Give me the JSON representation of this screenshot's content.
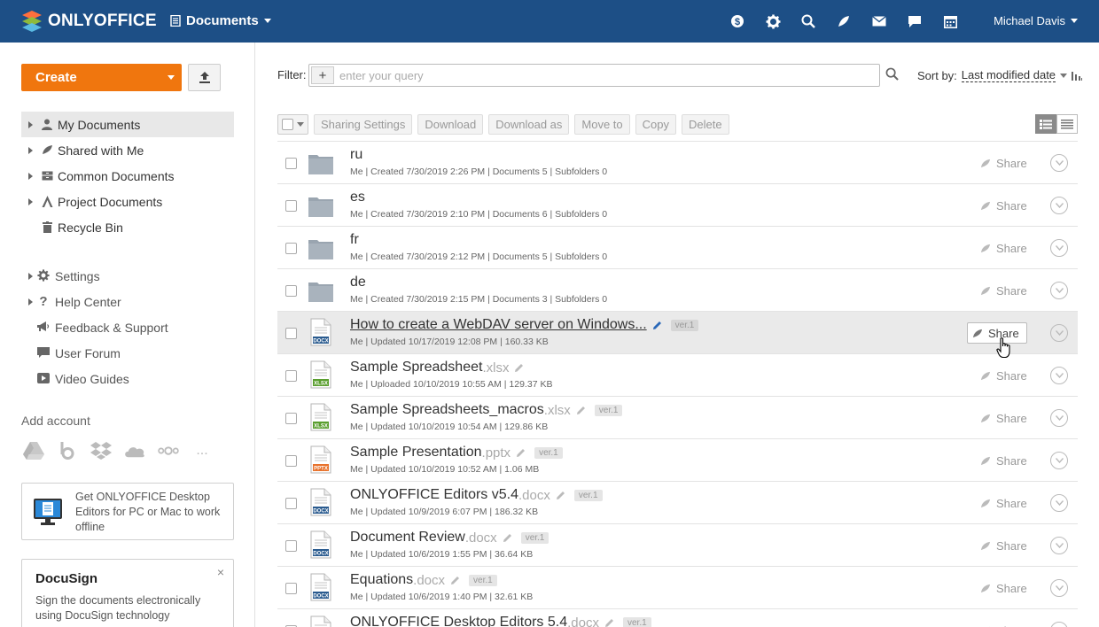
{
  "header": {
    "brand": "ONLYOFFICE",
    "module": "Documents",
    "user": "Michael Davis",
    "icons": [
      "payments-icon",
      "settings-icon",
      "search-icon",
      "feed-icon",
      "mail-icon",
      "talk-icon",
      "calendar-icon"
    ]
  },
  "sidebar": {
    "create_label": "Create",
    "tree": [
      {
        "label": "My Documents",
        "icon": "user-icon",
        "active": true
      },
      {
        "label": "Shared with Me",
        "icon": "share-icon"
      },
      {
        "label": "Common Documents",
        "icon": "common-icon"
      },
      {
        "label": "Project Documents",
        "icon": "project-icon"
      },
      {
        "label": "Recycle Bin",
        "icon": "trash-icon"
      }
    ],
    "links": [
      {
        "label": "Settings",
        "icon": "gear-icon"
      },
      {
        "label": "Help Center",
        "icon": "question-icon"
      },
      {
        "label": "Feedback & Support",
        "icon": "megaphone-icon"
      },
      {
        "label": "User Forum",
        "icon": "chat-icon"
      },
      {
        "label": "Video Guides",
        "icon": "video-icon"
      }
    ],
    "add_account": "Add account",
    "more": "...",
    "promo": "Get ONLYOFFICE Desktop Editors for PC or Mac to work offline",
    "docusign_brand": "DocuSign",
    "docusign_close": "×",
    "docusign_desc": "Sign the documents electronically using DocuSign technology"
  },
  "filter": {
    "label": "Filter:",
    "add": "+",
    "placeholder": "enter your query",
    "sort_label": "Sort by:",
    "sort_value": "Last modified date"
  },
  "toolbar": {
    "buttons": [
      "Sharing Settings",
      "Download",
      "Download as",
      "Move to",
      "Copy",
      "Delete"
    ]
  },
  "share_label": "Share",
  "rows": [
    {
      "type": "folder",
      "name": "ru",
      "ext": "",
      "meta": "Me | Created 7/30/2019 2:26 PM | Documents 5 | Subfolders 0"
    },
    {
      "type": "folder",
      "name": "es",
      "ext": "",
      "meta": "Me | Created 7/30/2019 2:10 PM | Documents 6 | Subfolders 0"
    },
    {
      "type": "folder",
      "name": "fr",
      "ext": "",
      "meta": "Me | Created 7/30/2019 2:12 PM | Documents 5 | Subfolders 0"
    },
    {
      "type": "folder",
      "name": "de",
      "ext": "",
      "meta": "Me | Created 7/30/2019 2:15 PM | Documents 3 | Subfolders 0"
    },
    {
      "type": "docx",
      "name": "How to create a WebDAV server on Windows...",
      "ext": "",
      "ver": "ver.1",
      "meta": "Me | Updated 10/17/2019 12:08 PM | 160.33 KB",
      "hover": true
    },
    {
      "type": "xlsx",
      "name": "Sample Spreadsheet",
      "ext": ".xlsx",
      "meta": "Me | Uploaded 10/10/2019 10:55 AM | 129.37 KB"
    },
    {
      "type": "xlsx",
      "name": "Sample Spreadsheets_macros",
      "ext": ".xlsx",
      "ver": "ver.1",
      "meta": "Me | Updated 10/10/2019 10:54 AM | 129.86 KB"
    },
    {
      "type": "pptx",
      "name": "Sample Presentation",
      "ext": ".pptx",
      "ver": "ver.1",
      "meta": "Me | Updated 10/10/2019 10:52 AM | 1.06 MB"
    },
    {
      "type": "docx",
      "name": "ONLYOFFICE Editors v5.4",
      "ext": ".docx",
      "ver": "ver.1",
      "meta": "Me | Updated 10/9/2019 6:07 PM | 186.32 KB"
    },
    {
      "type": "docx",
      "name": "Document Review",
      "ext": ".docx",
      "ver": "ver.1",
      "meta": "Me | Updated 10/6/2019 1:55 PM | 36.64 KB"
    },
    {
      "type": "docx",
      "name": "Equations",
      "ext": ".docx",
      "ver": "ver.1",
      "meta": "Me | Updated 10/6/2019 1:40 PM | 32.61 KB"
    },
    {
      "type": "docx",
      "name": "ONLYOFFICE Desktop Editors 5.4",
      "ext": ".docx",
      "ver": "ver.1",
      "meta": ""
    }
  ],
  "colors": {
    "header": "#1d4f86",
    "create": "#f0760e",
    "docx": "#2a5b8f",
    "xlsx": "#5a9e2f",
    "pptx": "#e8722c"
  }
}
